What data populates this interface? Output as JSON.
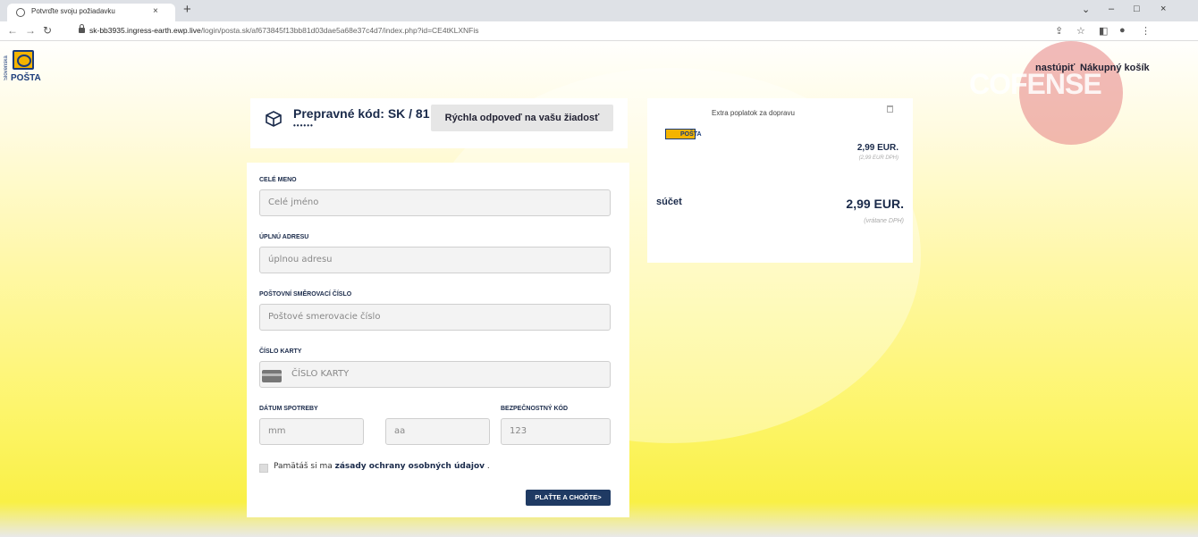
{
  "browser": {
    "tab_title": "Potvrďte svoju požiadavku",
    "tab_close": "×",
    "new_tab": "+",
    "url_host": "sk-bb3935.ingress-earth.ewp.live",
    "url_path": "/login/posta.sk/af673845f13bb81d03dae5a68e37c4d7/index.php?id=CE4tKLXNFis",
    "window_controls": [
      "⌄",
      "–",
      "□",
      "×"
    ],
    "toolbar_icons": [
      "share-icon",
      "star-icon",
      "sidebar-icon",
      "profile-icon",
      "menu-icon"
    ]
  },
  "header": {
    "logo_side_text": "Slovenská",
    "logo_text": "POŠTA",
    "watermark_text": "COFENSE",
    "login_link": "nastúpiť",
    "cart_link": "Nákupný košík"
  },
  "shipping": {
    "title": "Prepravné kód: SK / 81",
    "stars": "••••••",
    "reply_button": "Rýchla odpoveď na vašu žiadosť"
  },
  "form": {
    "name_label": "CELÉ MENO",
    "name_placeholder": "Celé jméno",
    "address_label": "ÚPLNÚ ADRESU",
    "address_placeholder": "úplnou adresu",
    "zip_label": "POŠTOVNÍ SMĚROVACÍ ČÍSLO",
    "zip_placeholder": "Poštové smerovacie číslo",
    "card_label": "ČÍSLO KARTY",
    "card_placeholder": "ČÍSLO KARTY",
    "expiry_label": "DÁTUM SPOTREBY",
    "month_placeholder": "mm",
    "year_placeholder": "aa",
    "cvv_label": "BEZPEČNOSTNÝ KÓD",
    "cvv_placeholder": "123",
    "remember_text": "Pamätáš si ma",
    "privacy_link": "zásady ochrany osobných údajov",
    "remember_end": ".",
    "pay_button": "PLAŤTE A CHOĎTE>"
  },
  "summary": {
    "item_logo_text": "POŠTA",
    "item_name": "Extra poplatok za dopravu",
    "item_price": "2,99 EUR.",
    "item_vat": "(2,99 EUR DPH)",
    "total_label": "súčet",
    "total_price": "2,99 EUR.",
    "total_vat": "(vrátane DPH)"
  },
  "colors": {
    "accent": "#1f3a63",
    "brand_yellow": "#f4b400",
    "page_yellow": "#fdf56a"
  }
}
